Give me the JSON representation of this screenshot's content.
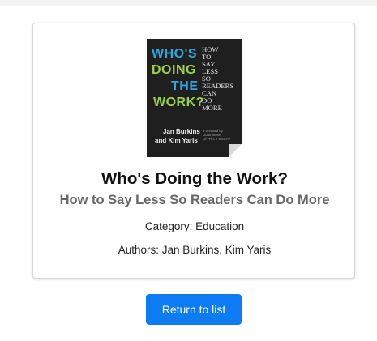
{
  "book": {
    "title": "Who's Doing the Work?",
    "subtitle": "How to Say Less So Readers Can Do More",
    "category": "Category: Education",
    "authors": "Authors: Jan Burkins, Kim Yaris"
  },
  "cover": {
    "words": [
      "WHO'S",
      "DOING",
      "THE",
      "WORK?"
    ],
    "word_colors": [
      "#2ea6e0",
      "#9bd145",
      "#2ea6e0",
      "#9bd145"
    ],
    "tagline": [
      "HOW",
      "TO",
      "SAY",
      "LESS",
      "SO",
      "READERS",
      "CAN",
      "DO",
      "MORE"
    ],
    "author_lines": [
      "Jan Burkins",
      "and Kim Yaris"
    ],
    "foreword_lines": [
      "Foreword by",
      "Joan Moser",
      "of \"The 2 Sisters\""
    ]
  },
  "actions": {
    "return_label": "Return to list"
  },
  "colors": {
    "primary": "#0d7bf2",
    "subtitle": "#666666",
    "cover_bg": "#1f1f1f"
  }
}
